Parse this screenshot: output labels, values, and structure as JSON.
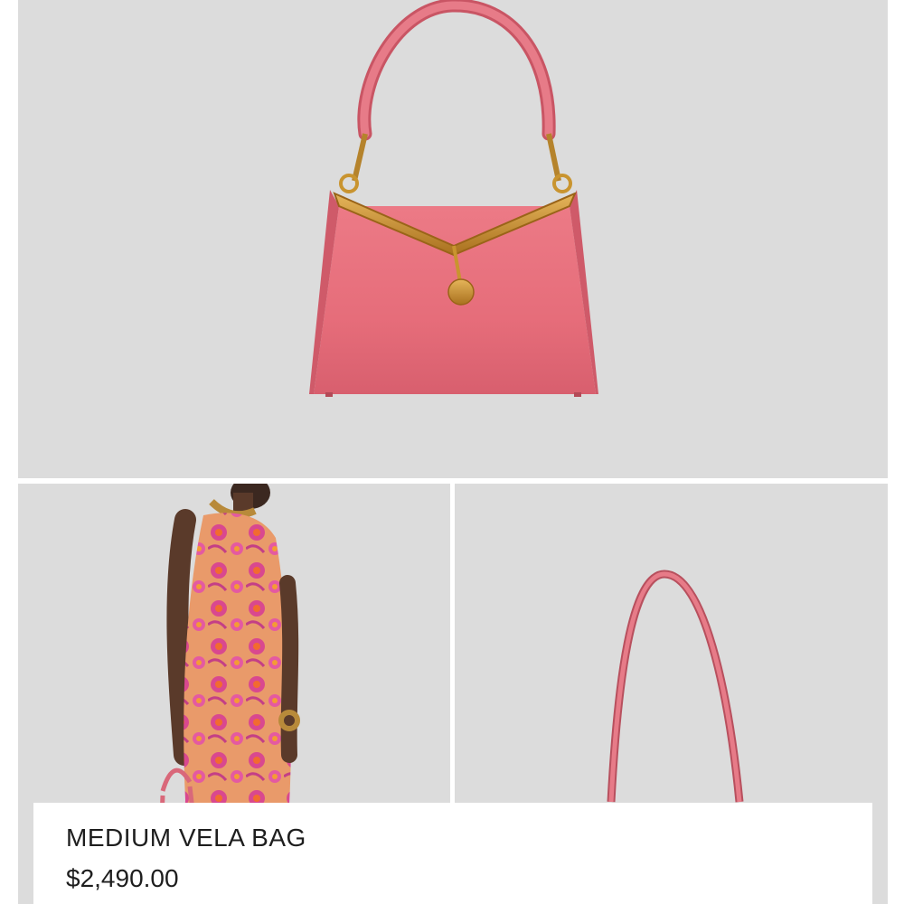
{
  "product": {
    "name": "MEDIUM VELA BAG",
    "price": "$2,490.00"
  },
  "gallery": {
    "images": [
      {
        "name": "product-main-image",
        "subject": "pink leather bag with gold frame, front view"
      },
      {
        "name": "product-model-image",
        "subject": "model wearing floral dress carrying the bag"
      },
      {
        "name": "product-strap-image",
        "subject": "close-up of bag shoulder strap"
      }
    ]
  },
  "colors": {
    "background": "#dcdcdc",
    "bag_pink": "#e86e7a",
    "hardware_gold": "#c8902e",
    "text": "#1e1e1e"
  }
}
